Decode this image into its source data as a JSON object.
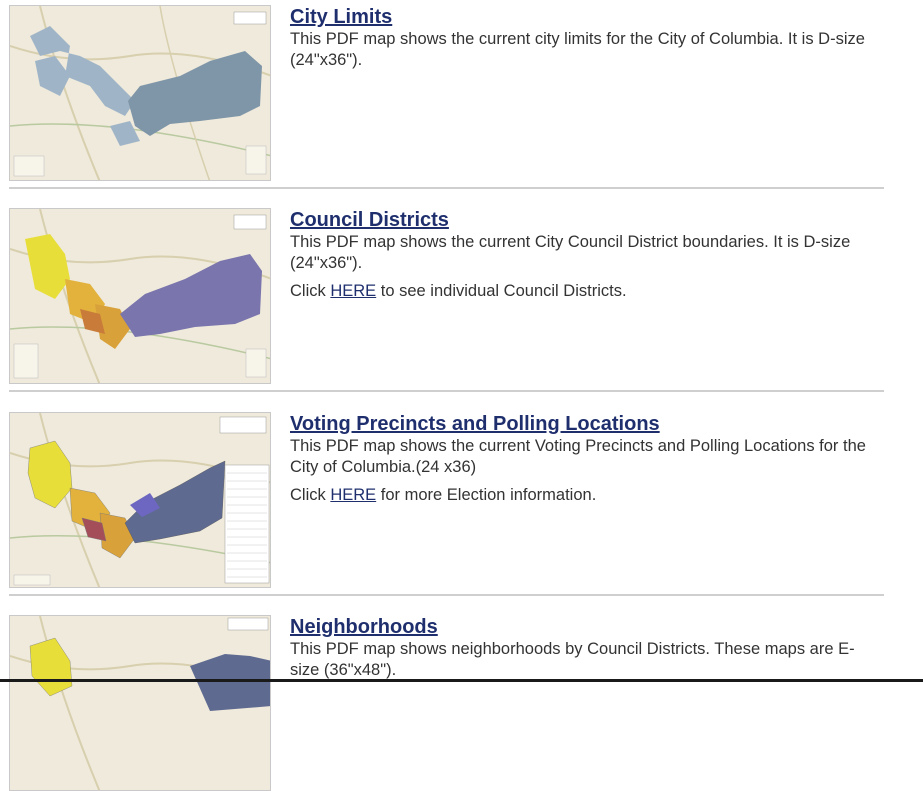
{
  "entries": [
    {
      "title": "City Limits",
      "description": "This PDF map shows the current city limits for the City of Columbia. It is D-size (24\"x36\").",
      "map_icon": "city-limits-map"
    },
    {
      "title": "Council Districts",
      "description": "This PDF map shows the current City Council District boundaries. It is D-size (24\"x36\").",
      "more_prefix": "Click ",
      "more_link": "HERE",
      "more_suffix": " to see individual Council Districts.",
      "map_icon": "council-districts-map"
    },
    {
      "title": "Voting Precincts and Polling Locations",
      "description": "This PDF map shows the current Voting Precincts and Polling Locations for the City of Columbia.(24 x36)",
      "more_prefix": "Click ",
      "more_link": "HERE",
      "more_suffix": " for more Election information.",
      "map_icon": "voting-precincts-map"
    },
    {
      "title": "Neighborhoods",
      "description": "This PDF map shows neighborhoods by Council Districts. These maps are E-size (36\"x48\").",
      "map_icon": "neighborhoods-map"
    }
  ],
  "colors": {
    "link": "#1f2f6e",
    "map_base": "#efeadb",
    "city_blue": "#8aa3b8",
    "district_purple": "#7a75ad",
    "district_yellow": "#e8de3a",
    "district_orange": "#d9a13a"
  }
}
